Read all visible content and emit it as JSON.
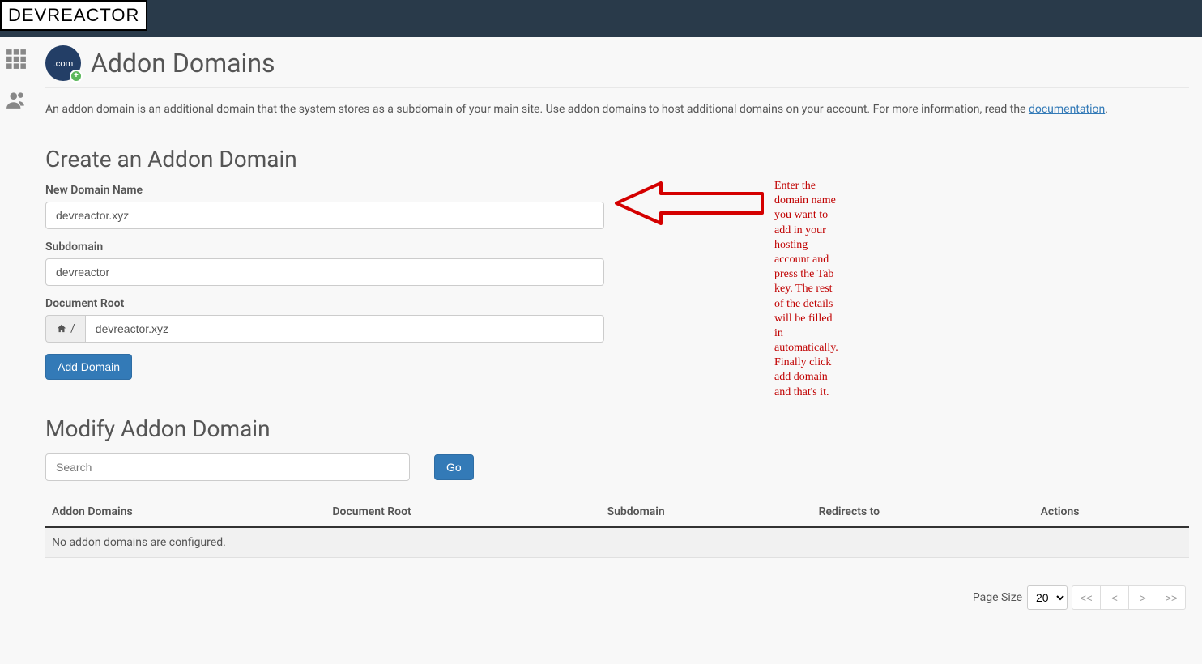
{
  "header": {
    "logo_text": "DEVREACTOR"
  },
  "page": {
    "title": "Addon Domains",
    "icon_text": ".com",
    "intro_prefix": "An addon domain is an additional domain that the system stores as a subdomain of your main site. Use addon domains to host additional domains on your account. For more information, read the ",
    "intro_link": "documentation",
    "intro_suffix": "."
  },
  "form": {
    "heading": "Create an Addon Domain",
    "new_domain_label": "New Domain Name",
    "new_domain_value": "devreactor.xyz",
    "subdomain_label": "Subdomain",
    "subdomain_value": "devreactor",
    "docroot_label": "Document Root",
    "docroot_prefix": "/",
    "docroot_value": "devreactor.xyz",
    "submit_label": "Add Domain"
  },
  "annotation": "Enter the domain name you want to add in your hosting account and press the Tab key. The rest of the details will be filled in automatically. Finally click add domain and that's it.",
  "modify": {
    "heading": "Modify Addon Domain",
    "search_placeholder": "Search",
    "go_label": "Go",
    "columns": {
      "addon_domains": "Addon Domains",
      "document_root": "Document Root",
      "subdomain": "Subdomain",
      "redirects_to": "Redirects to",
      "actions": "Actions"
    },
    "empty_row": "No addon domains are configured."
  },
  "pager": {
    "page_size_label": "Page Size",
    "page_size_value": "20",
    "first": "<<",
    "prev": "<",
    "next": ">",
    "last": ">>"
  }
}
